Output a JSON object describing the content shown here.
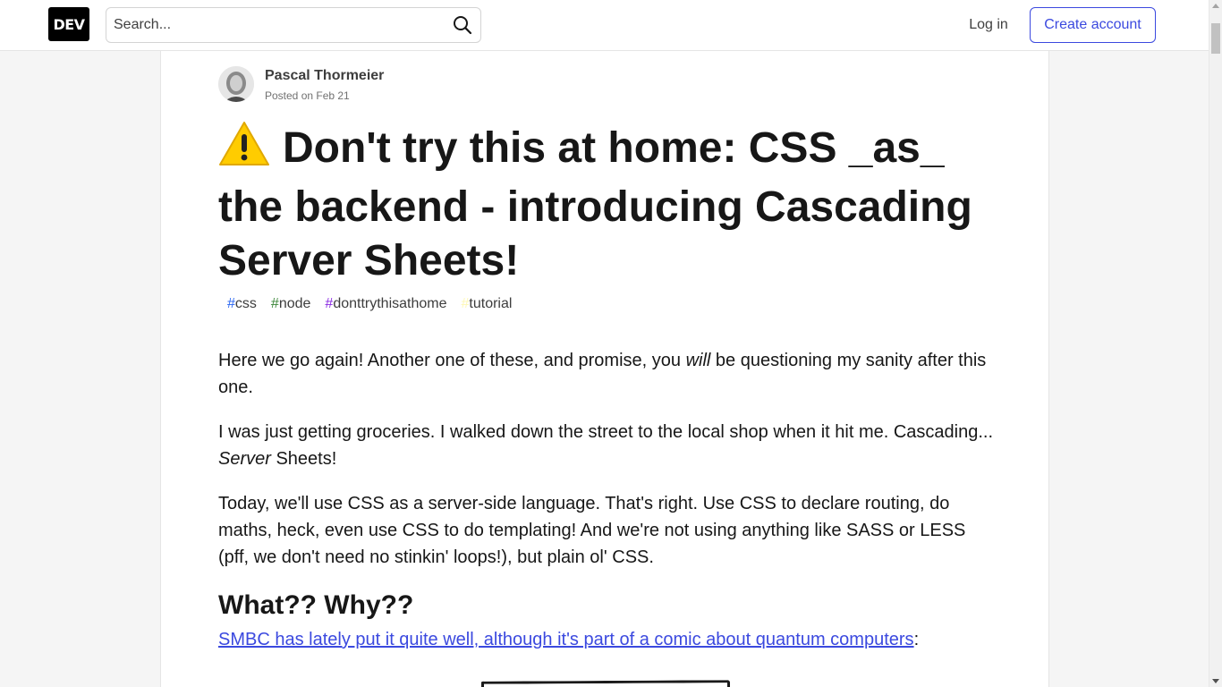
{
  "header": {
    "logo_text": "DEV",
    "search_placeholder": "Search...",
    "login_label": "Log in",
    "create_account_label": "Create account",
    "accent_color": "#3b49df"
  },
  "article": {
    "author": "Pascal Thormeier",
    "posted": "Posted on Feb 21",
    "title_emoji": "warning-icon",
    "title": "Don't try this at home: CSS _as_ the backend - introducing Cascading Server Sheets!",
    "tags": [
      {
        "hash": "#",
        "name": "css",
        "color": "#2965f1"
      },
      {
        "hash": "#",
        "name": "node",
        "color": "#3c873a"
      },
      {
        "hash": "#",
        "name": "donttrythisathome",
        "color": "#8a2be2"
      },
      {
        "hash": "#",
        "name": "tutorial",
        "color": "#fef8b5"
      }
    ],
    "p1_a": "Here we go again! Another one of these, and promise, you ",
    "p1_em": "will",
    "p1_b": " be questioning my sanity after this one.",
    "p2_a": "I was just getting groceries. I walked down the street to the local shop when it hit me. Cascading... ",
    "p2_em": "Server",
    "p2_b": " Sheets!",
    "p3": "Today, we'll use CSS as a server-side language. That's right. Use CSS to declare routing, do maths, heck, even use CSS to do templating! And we're not using anything like SASS or LESS (pff, we don't need no stinkin' loops!), but plain ol' CSS.",
    "heading": "What?? Why??",
    "link_text": "SMBC has lately put it quite well, although it's part of a comic about quantum computers",
    "link_suffix": ":"
  }
}
